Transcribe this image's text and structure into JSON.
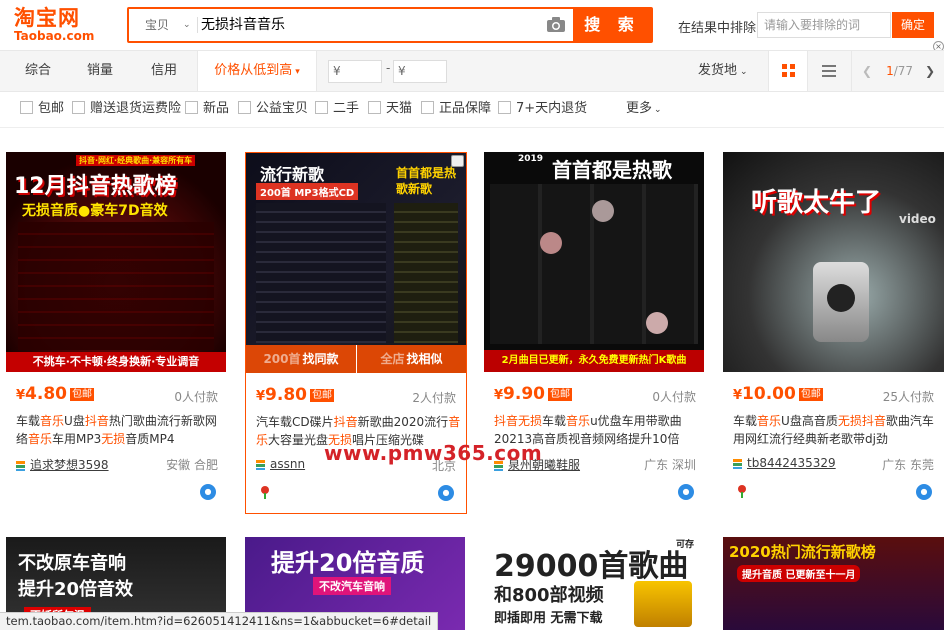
{
  "header": {
    "logo_cn": "淘宝网",
    "logo_en": "Taobao.com",
    "search_type": "宝贝",
    "search_query": "无损抖音音乐",
    "search_button": "搜 索",
    "exclude_label": "在结果中排除",
    "exclude_placeholder": "请输入要排除的词",
    "exclude_button": "确定"
  },
  "sortbar": {
    "tabs": [
      "综合",
      "销量",
      "信用",
      "价格从低到高"
    ],
    "price_min_placeholder": "¥",
    "price_max_placeholder": "¥",
    "price_dash": "-",
    "ship_from": "发货地",
    "page_current": "1",
    "page_total": "/77"
  },
  "filters": [
    "包邮",
    "赠送退货运费险",
    "新品",
    "公益宝贝",
    "二手",
    "天猫",
    "正品保障",
    "7+天内退货"
  ],
  "filters_more": "更多",
  "products": [
    {
      "price": "4.80",
      "yen": "¥",
      "badge": "包邮",
      "sold": "0人付款",
      "title_parts": [
        "车载",
        "音乐",
        "U盘",
        "抖音",
        "热门歌曲流行新歌网络",
        "音乐",
        "车用MP3",
        "无损",
        "音质MP4"
      ],
      "shop": "追求梦想3598",
      "location": "安徽 合肥",
      "img": {
        "line1": "12月抖音热歌榜",
        "line2": "无损音质●豪车7D音效",
        "tag": "抖音·网红·经典歌曲·兼容所有车",
        "foot": "不挑车·不卡顿·终身换新·专业调音"
      }
    },
    {
      "price": "9.80",
      "yen": "¥",
      "badge": "包邮",
      "sold": "2人付款",
      "title_parts": [
        "汽车载CD碟片",
        "抖音",
        "新歌曲2020流行",
        "音乐",
        "大容量光盘",
        "无损",
        "唱片压缩光碟"
      ],
      "shop": "assnn",
      "location": "北京",
      "img": {
        "line1": "流行新歌",
        "line2": "200首 MP3格式CD",
        "right": "首首都是热歌新歌",
        "same": "找同款",
        "similar": "找相似",
        "foot_left": "200首",
        "foot_right": "全店"
      }
    },
    {
      "price": "9.90",
      "yen": "¥",
      "badge": "包邮",
      "sold": "0人付款",
      "title_parts": [
        "抖音",
        "无损",
        "车载",
        "音乐",
        "u优盘车用带歌曲20213高音质视音频网络提升10倍"
      ],
      "shop": "泉州朝曦鞋服",
      "location": "广东 深圳",
      "img": {
        "year": "2019",
        "line1": "首首都是热歌",
        "foot": "2月曲目已更新，永久免费更新热门K歌曲"
      }
    },
    {
      "price": "10.00",
      "yen": "¥",
      "badge": "包邮",
      "sold": "25人付款",
      "title_parts": [
        "车载",
        "音乐",
        "U盘高音质",
        "无损",
        "抖音",
        "歌曲汽车用网红流行经典新老歌带dj劲"
      ],
      "shop": "tb8442435329",
      "location": "广东 东莞",
      "img": {
        "line1": "听歌太牛了",
        "word": "video"
      }
    }
  ],
  "row2": [
    {
      "line1": "不改原车音响",
      "line2": "提升20倍音效",
      "line3": "不妖所句温"
    },
    {
      "line1": "提升20倍音质",
      "line2": "不改汽车音响"
    },
    {
      "line1": "29000首歌曲",
      "line2": "和800部视频",
      "line3": "即插即用 无需下载",
      "tag": "可存"
    },
    {
      "line1": "2020热门流行新歌榜",
      "line2": "提升音质 已更新至十一月"
    }
  ],
  "watermark": "www.pmw365.com",
  "statusbar": "tem.taobao.com/item.htm?id=626051412411&ns=1&abbucket=6#detail",
  "colors": {
    "brand": "#ff5000",
    "link": "#3c3c3c"
  }
}
